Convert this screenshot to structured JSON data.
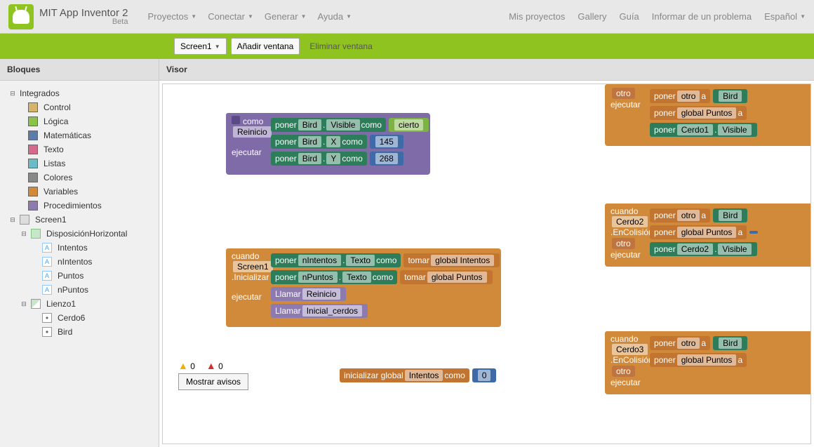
{
  "brand": {
    "title": "MIT App Inventor 2",
    "sub": "Beta"
  },
  "menu_left": {
    "projects": "Proyectos",
    "connect": "Conectar",
    "generate": "Generar",
    "help": "Ayuda"
  },
  "menu_right": {
    "my_projects": "Mis proyectos",
    "gallery": "Gallery",
    "guide": "Guía",
    "report": "Informar de un problema",
    "lang": "Español"
  },
  "greenbar": {
    "screen": "Screen1",
    "add": "Añadir ventana",
    "remove": "Eliminar ventana"
  },
  "panels": {
    "blocks": "Bloques",
    "viewer": "Visor"
  },
  "tree": {
    "builtin": "Integrados",
    "cats": {
      "control": "Control",
      "logic": "Lógica",
      "math": "Matemáticas",
      "text": "Texto",
      "lists": "Listas",
      "colors": "Colores",
      "variables": "Variables",
      "procedures": "Procedimientos"
    },
    "screen": "Screen1",
    "layout": "DisposiciónHorizontal",
    "labels": {
      "intentos": "Intentos",
      "nintentos": "nIntentos",
      "puntos": "Puntos",
      "npuntos": "nPuntos"
    },
    "canvas": "Lienzo1",
    "sprites": {
      "cerdo6": "Cerdo6",
      "bird": "Bird"
    }
  },
  "status": {
    "warn": "0",
    "err": "0",
    "show": "Mostrar avisos"
  },
  "blk": {
    "to": "como",
    "proc_name": "Reinicio",
    "execute": "ejecutar",
    "set": "poner",
    "to2": "como",
    "to3": "a",
    "bird": "Bird",
    "visible": "Visible",
    "x": "X",
    "y": "Y",
    "true": "cierto",
    "v145": "145",
    "v268": "268",
    "when": "cuando",
    "screen1": "Screen1",
    "init": ".Inicializar",
    "nIntentos": "nIntentos",
    "nPuntos": "nPuntos",
    "texto": "Texto",
    "get": "tomar",
    "gIntentos": "global Intentos",
    "gPuntos": "global Puntos",
    "call": "Llamar",
    "reinicio_f": "Reinicio",
    "inicial_c": "Inicial_cerdos",
    "otro": "otro",
    "other_f": "otro",
    "cerdo1": "Cerdo1",
    "cerdo2": "Cerdo2",
    "cerdo3": "Cerdo3",
    "collision": ".EnColisiónCon",
    "init_global": "inicializar global",
    "intentos": "Intentos",
    "como": "como",
    "zero": "0"
  }
}
